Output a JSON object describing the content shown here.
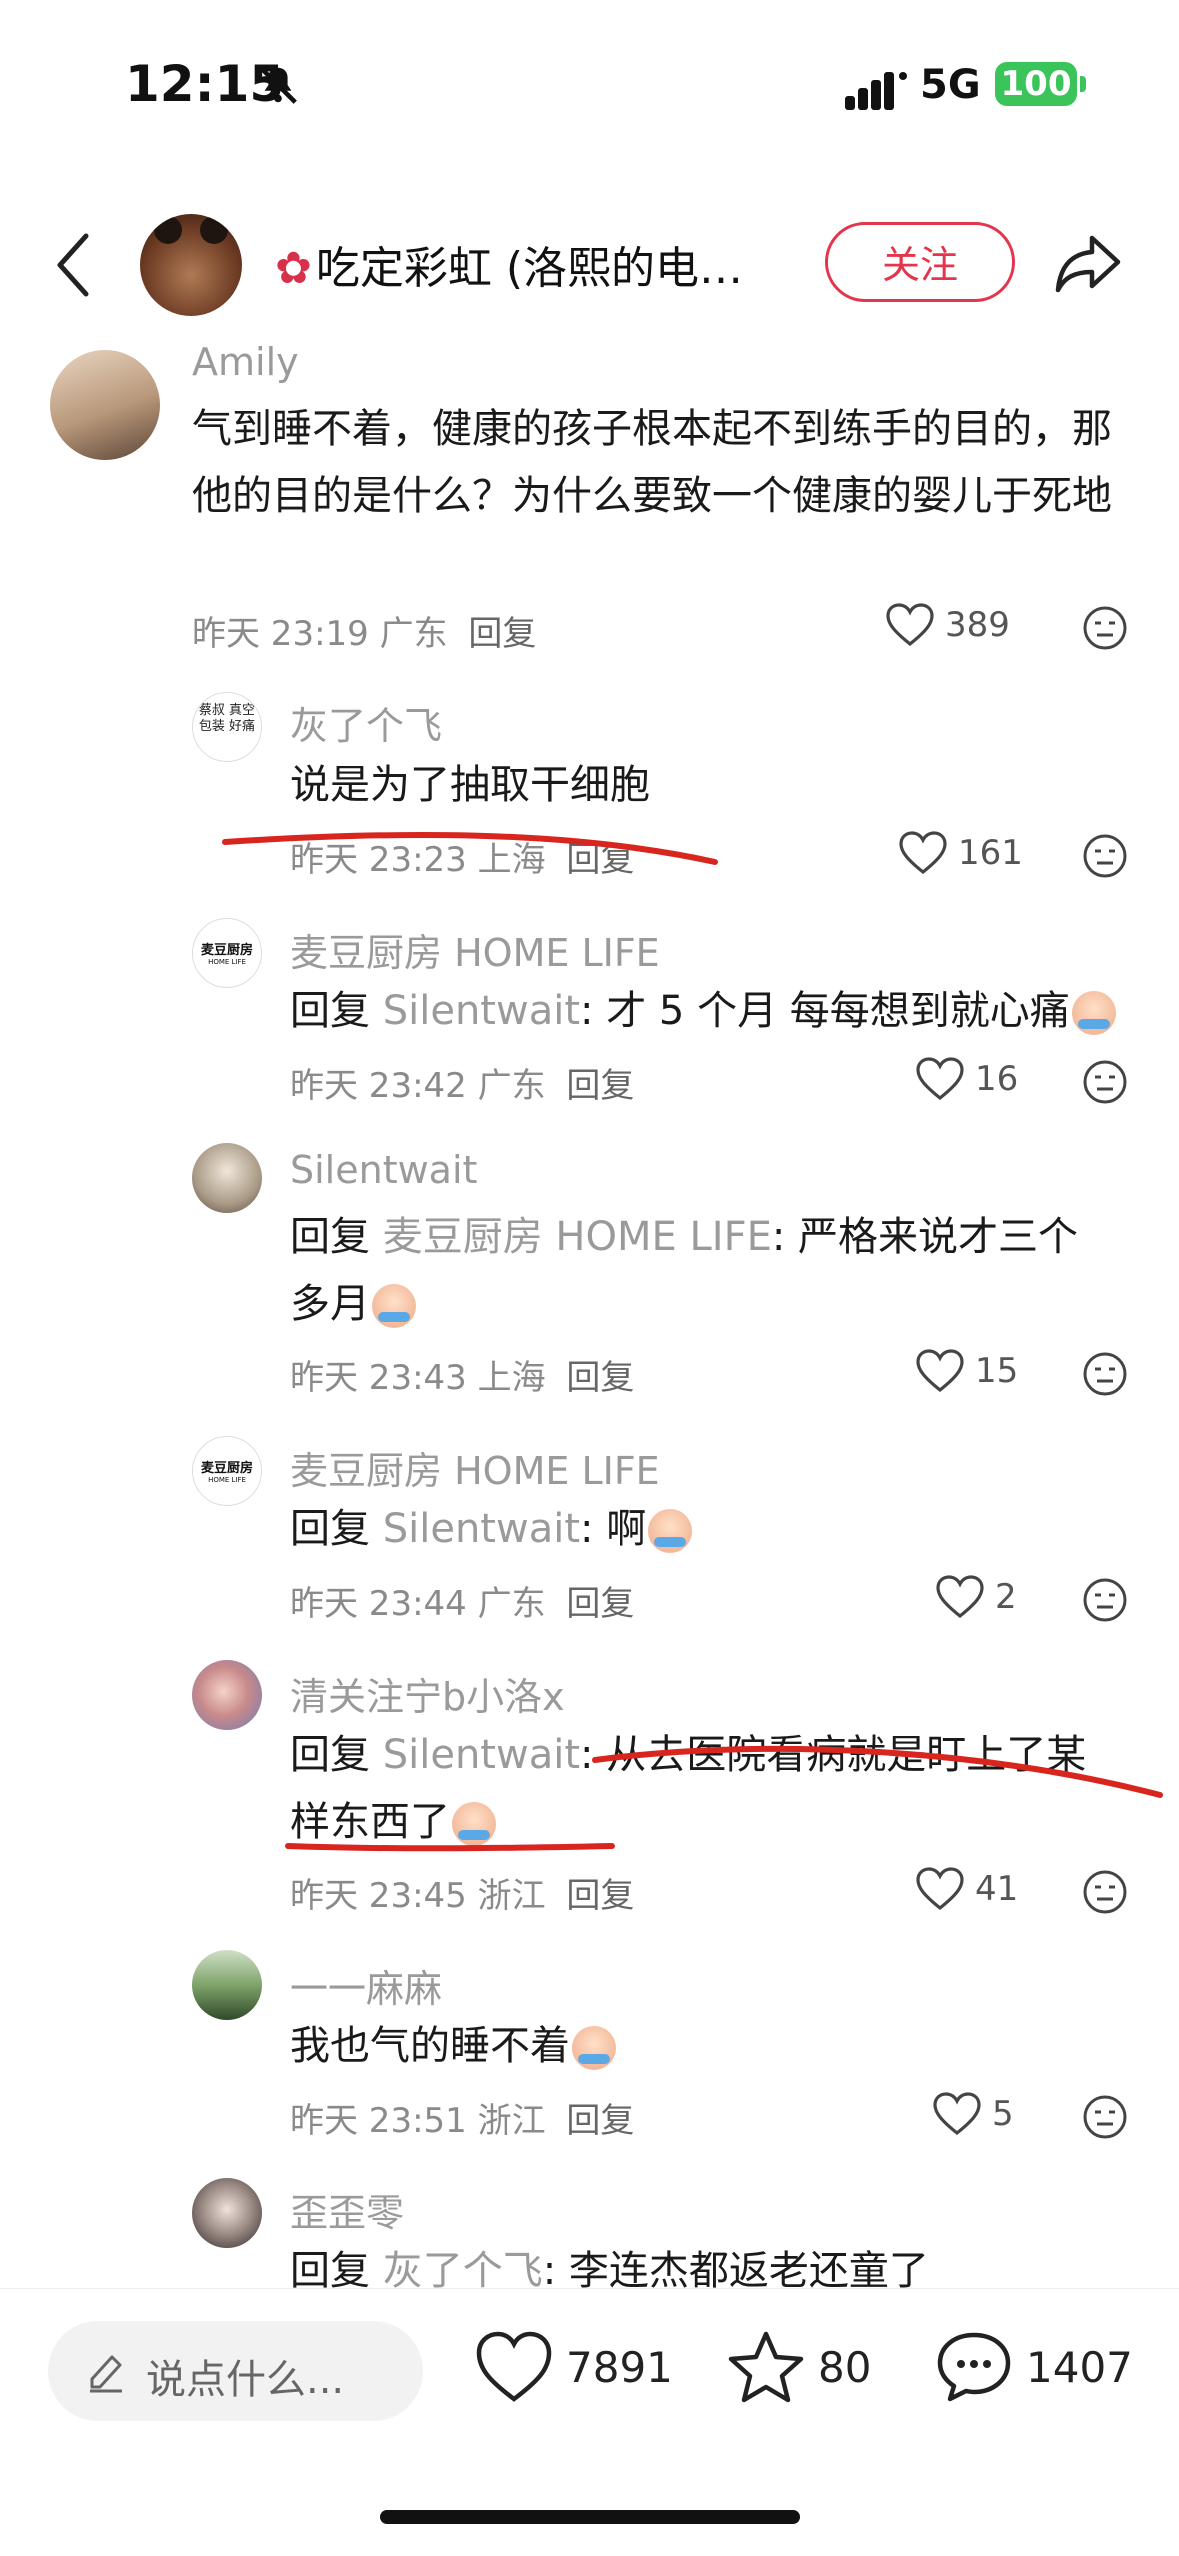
{
  "status_bar": {
    "time": "12:15",
    "network": "5G",
    "battery": "100"
  },
  "header": {
    "author_name": "吃定彩虹 (洛熙的电…",
    "follow_label": "关注",
    "icon_share": "share-icon",
    "icon_back": "back-icon"
  },
  "comments": [
    {
      "user": "Amily",
      "text": "气到睡不着，健康的孩子根本起不到练手的目的，那他的目的是什么？为什么要致一个健康的婴儿于死地",
      "time": "昨天 23:19",
      "location": "广东",
      "reply_label": "回复",
      "likes": "389"
    },
    {
      "user": "灰了个飞",
      "text": "说是为了抽取干细胞",
      "time": "昨天 23:23",
      "location": "上海",
      "reply_label": "回复",
      "likes": "161",
      "avatar_text": "蔡叔 真空包装 好痛"
    },
    {
      "user": "麦豆厨房 HOME LIFE",
      "reply_kw": "回复",
      "target": "Silentwait",
      "text": ": 才 5 个月 每每想到就心痛",
      "time": "昨天 23:42",
      "location": "广东",
      "reply_label": "回复",
      "likes": "16",
      "avatar_text": "麦豆厨房",
      "avatar_sub": "HOME LIFE"
    },
    {
      "user": "Silentwait",
      "reply_kw": "回复",
      "target": "麦豆厨房 HOME LIFE",
      "text": ": 严格来说才三个多月",
      "time": "昨天 23:43",
      "location": "上海",
      "reply_label": "回复",
      "likes": "15"
    },
    {
      "user": "麦豆厨房 HOME LIFE",
      "reply_kw": "回复",
      "target": "Silentwait",
      "text": ": 啊",
      "time": "昨天 23:44",
      "location": "广东",
      "reply_label": "回复",
      "likes": "2",
      "avatar_text": "麦豆厨房",
      "avatar_sub": "HOME LIFE"
    },
    {
      "user": "清关注宁b小洛x",
      "reply_kw": "回复",
      "target": "Silentwait",
      "text": ": 从去医院看病就是盯上了某样东西了",
      "time": "昨天 23:45",
      "location": "浙江",
      "reply_label": "回复",
      "likes": "41"
    },
    {
      "user": "一一麻麻",
      "text": "我也气的睡不着",
      "time": "昨天 23:51",
      "location": "浙江",
      "reply_label": "回复",
      "likes": "5"
    },
    {
      "user": "歪歪零",
      "reply_kw": "回复",
      "target": "灰了个飞",
      "text": ": 李连杰都返老还童了"
    }
  ],
  "bottom_bar": {
    "input_placeholder": "说点什么...",
    "likes": "7891",
    "stars": "80",
    "comments": "1407"
  },
  "colors": {
    "accent_red": "#e3354c",
    "battery_green": "#3bc45a",
    "annotation_red": "#d8261f"
  }
}
